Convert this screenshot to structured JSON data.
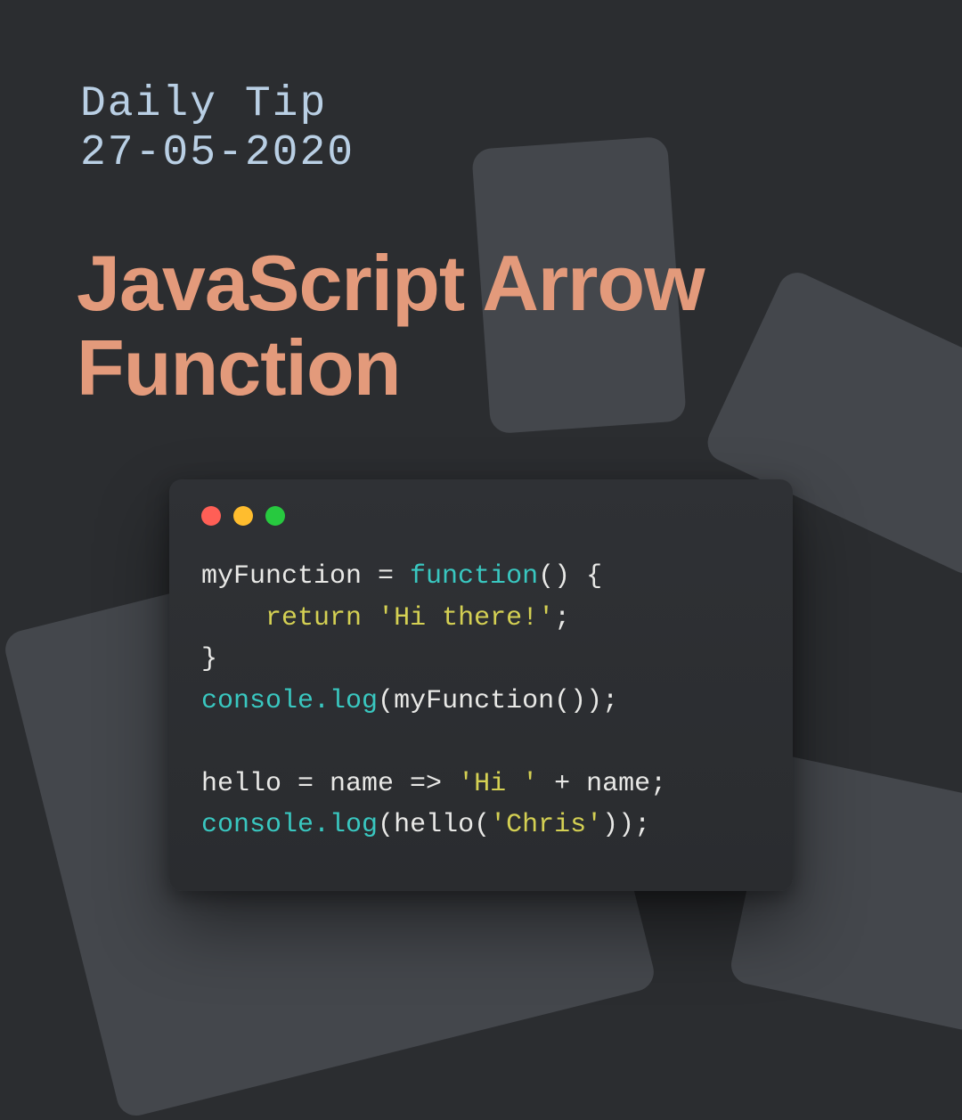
{
  "meta": {
    "tag": "Daily Tip",
    "date": "27-05-2020"
  },
  "headline": "JavaScript Arrow Function",
  "code": {
    "tokens": {
      "myFunction": "myFunction",
      "equals": " = ",
      "function_kw": "function",
      "parens_empty": "()",
      "brace_open": " {",
      "indent": "    ",
      "return_kw": "return",
      "space": " ",
      "str_hi_there": "'Hi there!'",
      "semi": ";",
      "brace_close": "}",
      "console_log": "console.log",
      "paren_open": "(",
      "paren_close": ")",
      "hello": "hello",
      "name": "name",
      "arrow": " => ",
      "str_hi_sp": "'Hi '",
      "plus": " + ",
      "str_chris": "'Chris'"
    }
  },
  "colors": {
    "bg": "#2b2d30",
    "shape": "#44474c",
    "meta_text": "#b9cfe4",
    "headline": "#e39a7b",
    "code_default": "#e8e8e6",
    "code_kw": "#39c7c0",
    "code_literal": "#d4d053",
    "traffic_red": "#ff5f56",
    "traffic_yellow": "#ffbd2e",
    "traffic_green": "#27c93f"
  }
}
